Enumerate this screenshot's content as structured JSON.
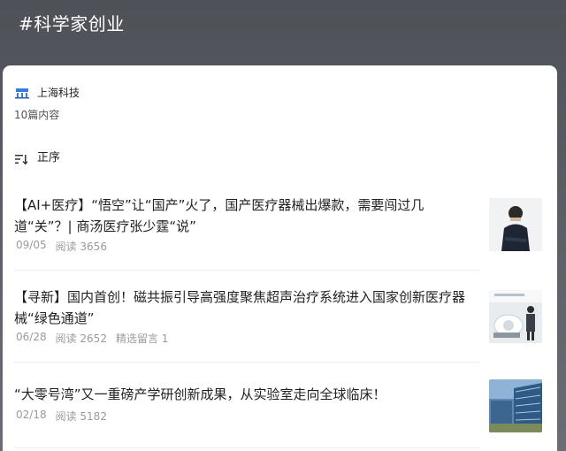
{
  "header": {
    "title": "#科学家创业"
  },
  "account": {
    "name": "上海科技"
  },
  "article_count": "10篇内容",
  "sort": {
    "label": "正序"
  },
  "articles": [
    {
      "title": "【AI+医疗】“悟空”让“国产”火了，国产医疗器械出爆款，需要闯过几道“关”？| 商汤医疗张少霆“说”",
      "date": "09/05",
      "reads": "阅读 3656",
      "extra": ""
    },
    {
      "title": "【寻新】国内首创！磁共振引导高强度聚焦超声治疗系统进入国家创新医疗器械“绿色通道”",
      "date": "06/28",
      "reads": "阅读 2652",
      "extra": "精选留言 1"
    },
    {
      "title": "“大零号湾”又一重磅产学研创新成果，从实验室走向全球临床！",
      "date": "02/18",
      "reads": "阅读 5182",
      "extra": ""
    }
  ],
  "colors": {
    "header_bg": "#55585e",
    "card_bg": "#ffffff",
    "meta": "#9a9a9a"
  },
  "icons": {
    "account_logo": "shanghai-tech-logo-icon",
    "sort": "sort-order-icon"
  }
}
